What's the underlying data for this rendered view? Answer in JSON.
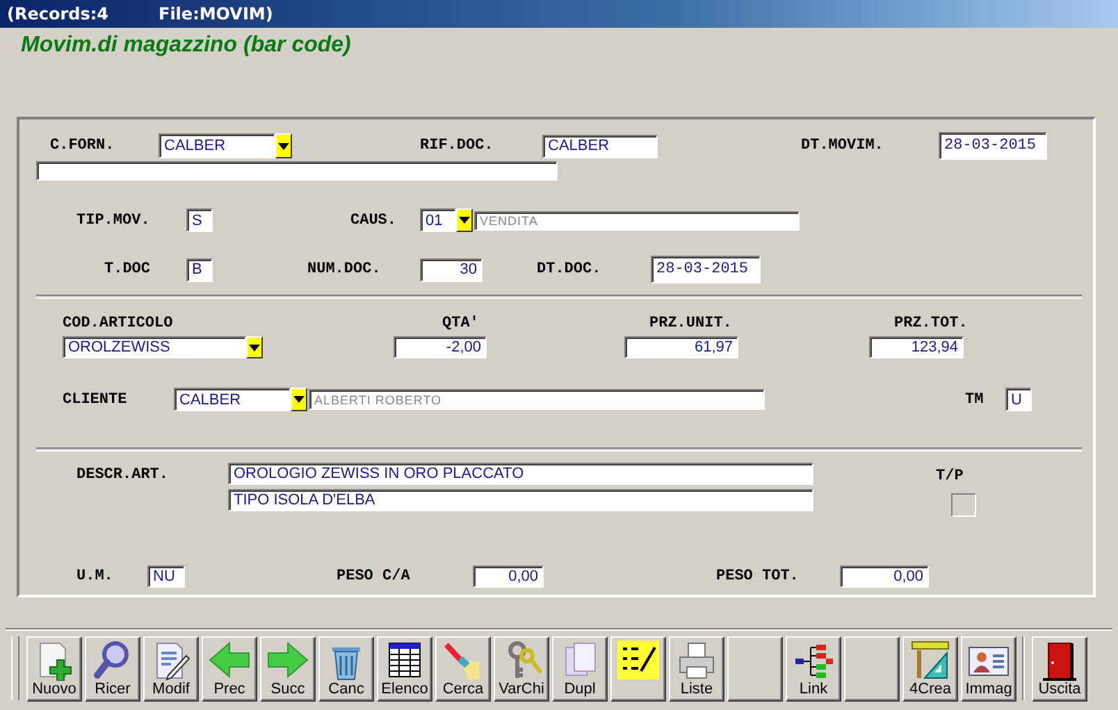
{
  "window": {
    "records": "(Records:4",
    "file": "File:MOVIM)"
  },
  "heading": "Movim.di magazzino (bar code)",
  "supplier": {
    "label": "C.FORN.",
    "value": "CALBER"
  },
  "doc_ref": {
    "label": "RIF.DOC.",
    "value": "CALBER"
  },
  "move_date": {
    "label": "DT.MOVIM.",
    "value": "28-03-2015"
  },
  "move_type": {
    "label": "TIP.MOV.",
    "value": "S"
  },
  "reason": {
    "label": "CAUS.",
    "value": "01",
    "description": "VENDITA"
  },
  "doc_type": {
    "label": "T.DOC",
    "value": "B"
  },
  "doc_number": {
    "label": "NUM.DOC.",
    "value": "30"
  },
  "doc_date": {
    "label": "DT.DOC.",
    "value": "28-03-2015"
  },
  "article": {
    "label": "COD.ARTICOLO",
    "value": "OROLZEWISS"
  },
  "quantity": {
    "label": "QTA'",
    "value": "-2,00"
  },
  "unit_price": {
    "label": "PRZ.UNIT.",
    "value": "61,97"
  },
  "total_price": {
    "label": "PRZ.TOT.",
    "value": "123,94"
  },
  "customer": {
    "label": "CLIENTE",
    "value": "CALBER",
    "description": "ALBERTI ROBERTO"
  },
  "tm": {
    "label": "TM",
    "value": "U"
  },
  "description": {
    "label": "DESCR.ART.",
    "lines": [
      "OROLOGIO ZEWISS IN ORO PLACCATO",
      "TIPO ISOLA D'ELBA"
    ]
  },
  "tp": {
    "label": "T/P",
    "checked": false
  },
  "unit": {
    "label": "U.M.",
    "value": "NU"
  },
  "weight_ca": {
    "label": "PESO C/A",
    "value": "0,00"
  },
  "weight_total": {
    "label": "PESO TOT.",
    "value": "0,00"
  },
  "toolbar": [
    {
      "kind": "new",
      "label": "Nuovo"
    },
    {
      "kind": "search",
      "label": "Ricer"
    },
    {
      "kind": "edit",
      "label": "Modif"
    },
    {
      "kind": "prev",
      "label": "Prec"
    },
    {
      "kind": "next",
      "label": "Succ"
    },
    {
      "kind": "delete",
      "label": "Canc"
    },
    {
      "kind": "table",
      "label": "Elenco"
    },
    {
      "kind": "find",
      "label": "Cerca"
    },
    {
      "kind": "keys",
      "label": "VarChi"
    },
    {
      "kind": "copy",
      "label": "Dupl"
    },
    {
      "kind": "checklist"
    },
    {
      "kind": "print",
      "label": "Liste"
    },
    {
      "kind": "blank"
    },
    {
      "kind": "link",
      "label": "Link"
    },
    {
      "kind": "blank"
    },
    {
      "kind": "create",
      "label": "4Crea"
    },
    {
      "kind": "image",
      "label": "Immag"
    },
    {
      "kind": "exit",
      "label": "Uscita"
    }
  ]
}
